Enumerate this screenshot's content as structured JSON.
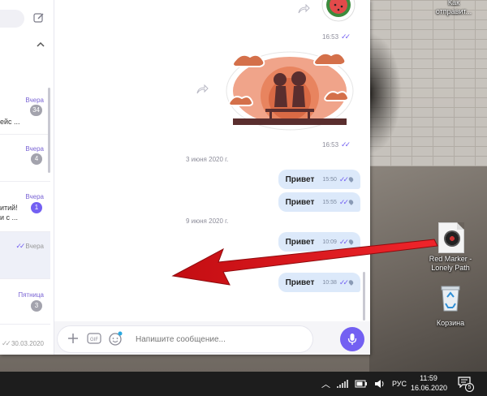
{
  "desktop": {
    "top_label": "Как\nотправит...",
    "file_label": "Red Marker -\nLonely Path",
    "recycle_label": "Корзина"
  },
  "chat_list": {
    "items": [
      {
        "time": "Вчера",
        "badge": "34",
        "snippet": "ейс ..."
      },
      {
        "time": "Вчера",
        "badge": "4",
        "snippet": ""
      },
      {
        "time": "Вчера",
        "badge": "1",
        "snippet": "итий!\nи с ..."
      },
      {
        "time": "Вчера",
        "badge": "",
        "snippet": ""
      },
      {
        "time": "Пятница",
        "badge": "3",
        "snippet": ""
      },
      {
        "time": "30.03.2020",
        "badge": "",
        "snippet": ""
      }
    ]
  },
  "conversation": {
    "sticker_top_time": "16:53",
    "sticker_main_time": "16:53",
    "date_1": "3 июня 2020 г.",
    "date_2": "9 июня 2020 г.",
    "partial_date": "...ра",
    "messages": [
      {
        "text": "Привет",
        "time": "15:50"
      },
      {
        "text": "Привет",
        "time": "15:55"
      },
      {
        "text": "Привет",
        "time": "10:09"
      },
      {
        "text": "Привет",
        "time": "10:38"
      }
    ]
  },
  "composer": {
    "placeholder": "Напишите сообщение...",
    "gif_label": "GIF"
  },
  "taskbar": {
    "language": "РУС",
    "time": "11:59",
    "date": "16.06.2020",
    "notifications": "5"
  },
  "colors": {
    "accent": "#7360f2",
    "bubble": "#dce9fa",
    "arrow": "#e4141b"
  }
}
